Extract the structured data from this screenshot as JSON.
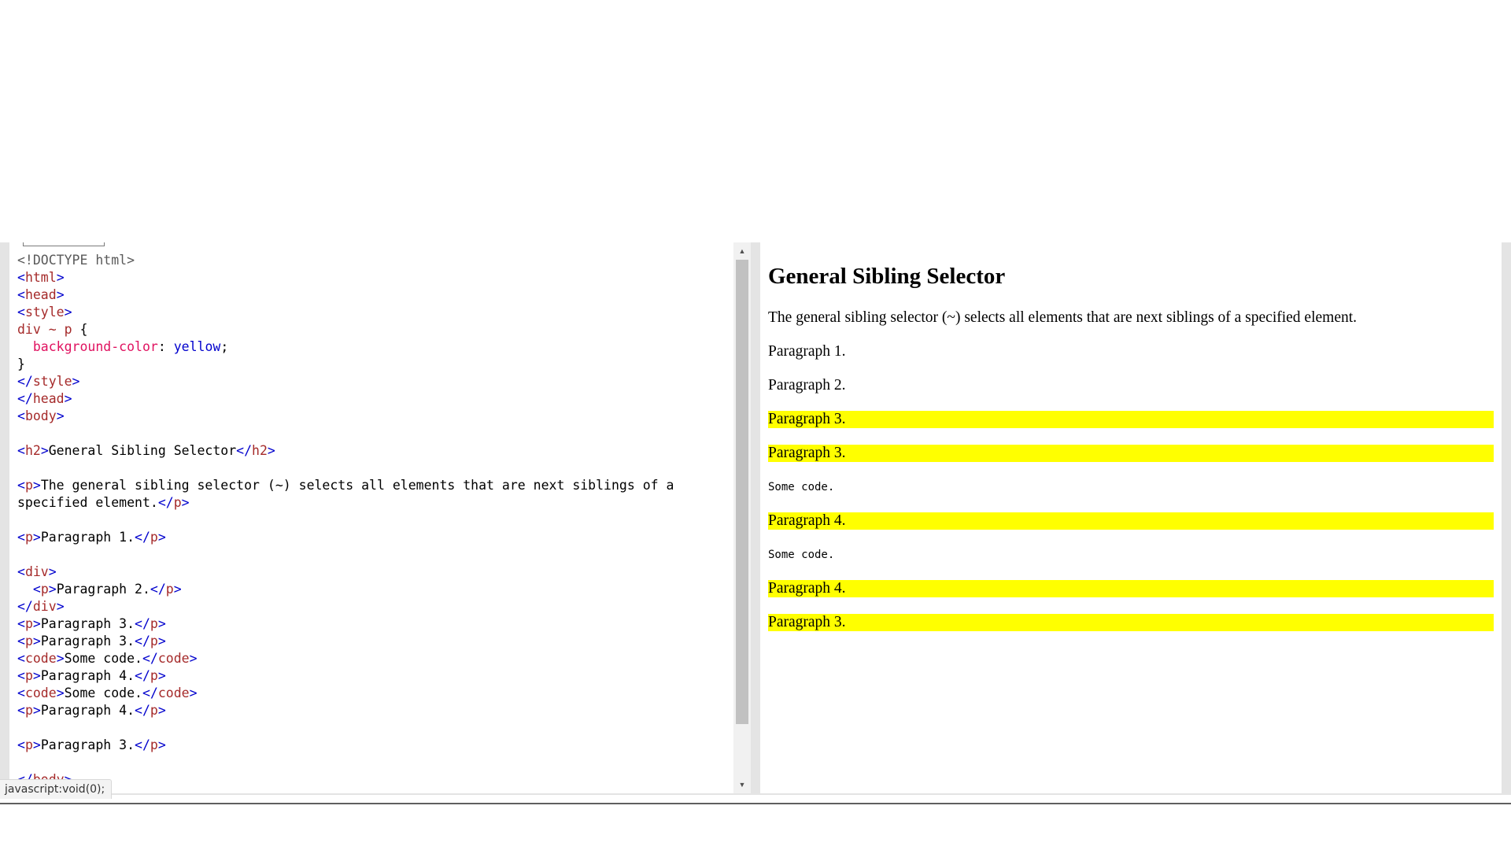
{
  "editor": {
    "lines": [
      [
        {
          "t": "doc",
          "s": "<!DOCTYPE html>"
        }
      ],
      [
        {
          "t": "brk",
          "s": "<"
        },
        {
          "t": "tag",
          "s": "html"
        },
        {
          "t": "brk",
          "s": ">"
        }
      ],
      [
        {
          "t": "brk",
          "s": "<"
        },
        {
          "t": "tag",
          "s": "head"
        },
        {
          "t": "brk",
          "s": ">"
        }
      ],
      [
        {
          "t": "brk",
          "s": "<"
        },
        {
          "t": "tag",
          "s": "style"
        },
        {
          "t": "brk",
          "s": ">"
        }
      ],
      [
        {
          "t": "sel",
          "s": "div ~ p"
        },
        {
          "t": "txt",
          "s": " {"
        }
      ],
      [
        {
          "t": "txt",
          "s": "  "
        },
        {
          "t": "prop",
          "s": "background-color"
        },
        {
          "t": "txt",
          "s": ": "
        },
        {
          "t": "val",
          "s": "yellow"
        },
        {
          "t": "txt",
          "s": ";"
        }
      ],
      [
        {
          "t": "txt",
          "s": "}"
        }
      ],
      [
        {
          "t": "brk",
          "s": "</"
        },
        {
          "t": "tag",
          "s": "style"
        },
        {
          "t": "brk",
          "s": ">"
        }
      ],
      [
        {
          "t": "brk",
          "s": "</"
        },
        {
          "t": "tag",
          "s": "head"
        },
        {
          "t": "brk",
          "s": ">"
        }
      ],
      [
        {
          "t": "brk",
          "s": "<"
        },
        {
          "t": "tag",
          "s": "body"
        },
        {
          "t": "brk",
          "s": ">"
        }
      ],
      [],
      [
        {
          "t": "brk",
          "s": "<"
        },
        {
          "t": "tag",
          "s": "h2"
        },
        {
          "t": "brk",
          "s": ">"
        },
        {
          "t": "txt",
          "s": "General Sibling Selector"
        },
        {
          "t": "brk",
          "s": "</"
        },
        {
          "t": "tag",
          "s": "h2"
        },
        {
          "t": "brk",
          "s": ">"
        }
      ],
      [],
      [
        {
          "t": "brk",
          "s": "<"
        },
        {
          "t": "tag",
          "s": "p"
        },
        {
          "t": "brk",
          "s": ">"
        },
        {
          "t": "txt",
          "s": "The general sibling selector (~) selects all elements that are next siblings of a"
        }
      ],
      [
        {
          "t": "txt",
          "s": "specified element."
        },
        {
          "t": "brk",
          "s": "</"
        },
        {
          "t": "tag",
          "s": "p"
        },
        {
          "t": "brk",
          "s": ">"
        }
      ],
      [],
      [
        {
          "t": "brk",
          "s": "<"
        },
        {
          "t": "tag",
          "s": "p"
        },
        {
          "t": "brk",
          "s": ">"
        },
        {
          "t": "txt",
          "s": "Paragraph 1."
        },
        {
          "t": "brk",
          "s": "</"
        },
        {
          "t": "tag",
          "s": "p"
        },
        {
          "t": "brk",
          "s": ">"
        }
      ],
      [],
      [
        {
          "t": "brk",
          "s": "<"
        },
        {
          "t": "tag",
          "s": "div"
        },
        {
          "t": "brk",
          "s": ">"
        }
      ],
      [
        {
          "t": "txt",
          "s": "  "
        },
        {
          "t": "brk",
          "s": "<"
        },
        {
          "t": "tag",
          "s": "p"
        },
        {
          "t": "brk",
          "s": ">"
        },
        {
          "t": "txt",
          "s": "Paragraph 2."
        },
        {
          "t": "brk",
          "s": "</"
        },
        {
          "t": "tag",
          "s": "p"
        },
        {
          "t": "brk",
          "s": ">"
        }
      ],
      [
        {
          "t": "brk",
          "s": "</"
        },
        {
          "t": "tag",
          "s": "div"
        },
        {
          "t": "brk",
          "s": ">"
        }
      ],
      [
        {
          "t": "brk",
          "s": "<"
        },
        {
          "t": "tag",
          "s": "p"
        },
        {
          "t": "brk",
          "s": ">"
        },
        {
          "t": "txt",
          "s": "Paragraph 3."
        },
        {
          "t": "brk",
          "s": "</"
        },
        {
          "t": "tag",
          "s": "p"
        },
        {
          "t": "brk",
          "s": ">"
        }
      ],
      [
        {
          "t": "brk",
          "s": "<"
        },
        {
          "t": "tag",
          "s": "p"
        },
        {
          "t": "brk",
          "s": ">"
        },
        {
          "t": "txt",
          "s": "Paragraph 3."
        },
        {
          "t": "brk",
          "s": "</"
        },
        {
          "t": "tag",
          "s": "p"
        },
        {
          "t": "brk",
          "s": ">"
        }
      ],
      [
        {
          "t": "brk",
          "s": "<"
        },
        {
          "t": "tag",
          "s": "code"
        },
        {
          "t": "brk",
          "s": ">"
        },
        {
          "t": "txt",
          "s": "Some code."
        },
        {
          "t": "brk",
          "s": "</"
        },
        {
          "t": "tag",
          "s": "code"
        },
        {
          "t": "brk",
          "s": ">"
        }
      ],
      [
        {
          "t": "brk",
          "s": "<"
        },
        {
          "t": "tag",
          "s": "p"
        },
        {
          "t": "brk",
          "s": ">"
        },
        {
          "t": "txt",
          "s": "Paragraph 4."
        },
        {
          "t": "brk",
          "s": "</"
        },
        {
          "t": "tag",
          "s": "p"
        },
        {
          "t": "brk",
          "s": ">"
        }
      ],
      [
        {
          "t": "brk",
          "s": "<"
        },
        {
          "t": "tag",
          "s": "code"
        },
        {
          "t": "brk",
          "s": ">"
        },
        {
          "t": "txt",
          "s": "Some code."
        },
        {
          "t": "brk",
          "s": "</"
        },
        {
          "t": "tag",
          "s": "code"
        },
        {
          "t": "brk",
          "s": ">"
        }
      ],
      [
        {
          "t": "brk",
          "s": "<"
        },
        {
          "t": "tag",
          "s": "p"
        },
        {
          "t": "brk",
          "s": ">"
        },
        {
          "t": "txt",
          "s": "Paragraph 4."
        },
        {
          "t": "brk",
          "s": "</"
        },
        {
          "t": "tag",
          "s": "p"
        },
        {
          "t": "brk",
          "s": ">"
        }
      ],
      [],
      [
        {
          "t": "brk",
          "s": "<"
        },
        {
          "t": "tag",
          "s": "p"
        },
        {
          "t": "brk",
          "s": ">"
        },
        {
          "t": "txt",
          "s": "Paragraph 3."
        },
        {
          "t": "brk",
          "s": "</"
        },
        {
          "t": "tag",
          "s": "p"
        },
        {
          "t": "brk",
          "s": ">"
        }
      ],
      [],
      [
        {
          "t": "brk",
          "s": "</"
        },
        {
          "t": "tag",
          "s": "body"
        },
        {
          "t": "brk",
          "s": ">"
        }
      ]
    ]
  },
  "result": {
    "heading": "General Sibling Selector",
    "description": "The general sibling selector (~) selects all elements that are next siblings of a specified element.",
    "items": [
      {
        "kind": "p",
        "text": "Paragraph 1.",
        "highlight": false
      },
      {
        "kind": "p",
        "text": "Paragraph 2.",
        "highlight": false
      },
      {
        "kind": "p",
        "text": "Paragraph 3.",
        "highlight": true
      },
      {
        "kind": "p",
        "text": "Paragraph 3.",
        "highlight": true
      },
      {
        "kind": "code",
        "text": "Some code.",
        "highlight": false
      },
      {
        "kind": "p",
        "text": "Paragraph 4.",
        "highlight": true
      },
      {
        "kind": "code",
        "text": "Some code.",
        "highlight": false
      },
      {
        "kind": "p",
        "text": "Paragraph 4.",
        "highlight": true
      },
      {
        "kind": "p",
        "text": "Paragraph 3.",
        "highlight": true
      }
    ],
    "highlight_color": "#ffff00"
  },
  "scrollbar": {
    "up_icon": "triangle-up-icon",
    "down_icon": "triangle-down-icon"
  },
  "status_bar": {
    "text": "javascript:void(0);"
  },
  "colors": {
    "bracket": "#0000cd",
    "tag": "#a52a2a",
    "property": "#e0115f",
    "value": "#0000cd"
  }
}
